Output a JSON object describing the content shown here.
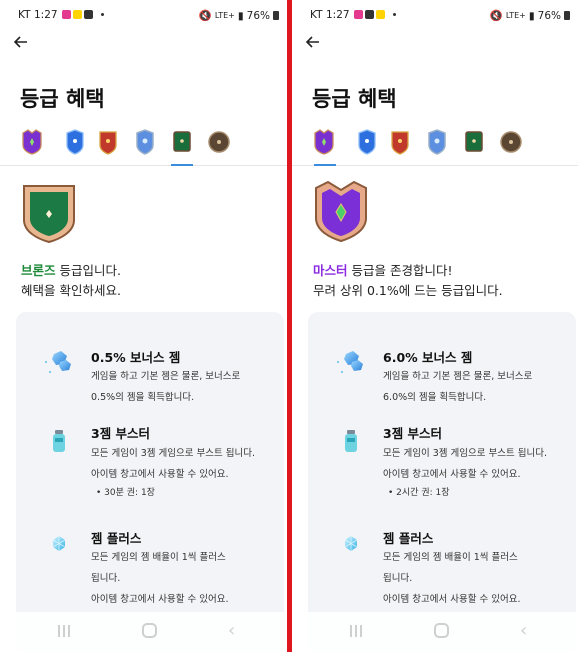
{
  "status_bar": {
    "carrier": "KT",
    "time": "1:27",
    "network": "LTE+",
    "battery": "76%"
  },
  "colors": {
    "divider": "#e0161e",
    "bronze_text": "#1f8a3a",
    "master_text": "#8a2be2",
    "tab_underline": "#3a8dde",
    "card_bg": "#f2f4f7"
  },
  "tier_icons": [
    "master-shield-icon",
    "sapphire-shield-icon",
    "ruby-shield-icon",
    "diamond-shield-icon",
    "emerald-shield-icon",
    "bronze-shield-icon"
  ],
  "left": {
    "title": "등급 혜택",
    "selected_tab": 5,
    "tier_name": "브론즈",
    "message_line1_suffix": " 등급입니다.",
    "message_line2": "혜택을 확인하세요.",
    "benefits": [
      {
        "icon": "gems-icon",
        "title": "0.5% 보너스 젬",
        "desc1": "게임을 하고 기본 젬은 물론, 보너스로",
        "desc2": "0.5%의 젬을 획득합니다."
      },
      {
        "icon": "booster-bottle-icon",
        "title": "3젬 부스터",
        "desc1": "모든 게임이 3젬 게임으로 부스트 됩니다.",
        "desc2": "아이템 창고에서 사용할 수 있어요.",
        "bullet": "30분 권: 1장"
      },
      {
        "icon": "gem-plus-icon",
        "title": "젬 플러스",
        "desc1": "모든 게임의 젬 배율이 1씩 플러스",
        "desc2": "됩니다.",
        "desc3": "아이템 창고에서 사용할 수 있어요."
      }
    ]
  },
  "right": {
    "title": "등급 혜택",
    "selected_tab": 0,
    "tier_name": "마스터",
    "message_line1_suffix": " 등급을 존경합니다!",
    "message_line2": "무려 상위 0.1%에 드는 등급입니다.",
    "benefits": [
      {
        "icon": "gems-icon",
        "title": "6.0% 보너스 젬",
        "desc1": "게임을 하고 기본 젬은 물론, 보너스로",
        "desc2": "6.0%의 젬을 획득합니다."
      },
      {
        "icon": "booster-bottle-icon",
        "title": "3젬 부스터",
        "desc1": "모든 게임이 3젬 게임으로 부스트 됩니다.",
        "desc2": "아이템 창고에서 사용할 수 있어요.",
        "bullet": "2시간 권: 1장"
      },
      {
        "icon": "gem-plus-icon",
        "title": "젬 플러스",
        "desc1": "모든 게임의 젬 배율이 1씩 플러스",
        "desc2": "됩니다.",
        "desc3": "아이템 창고에서 사용할 수 있어요."
      }
    ]
  }
}
